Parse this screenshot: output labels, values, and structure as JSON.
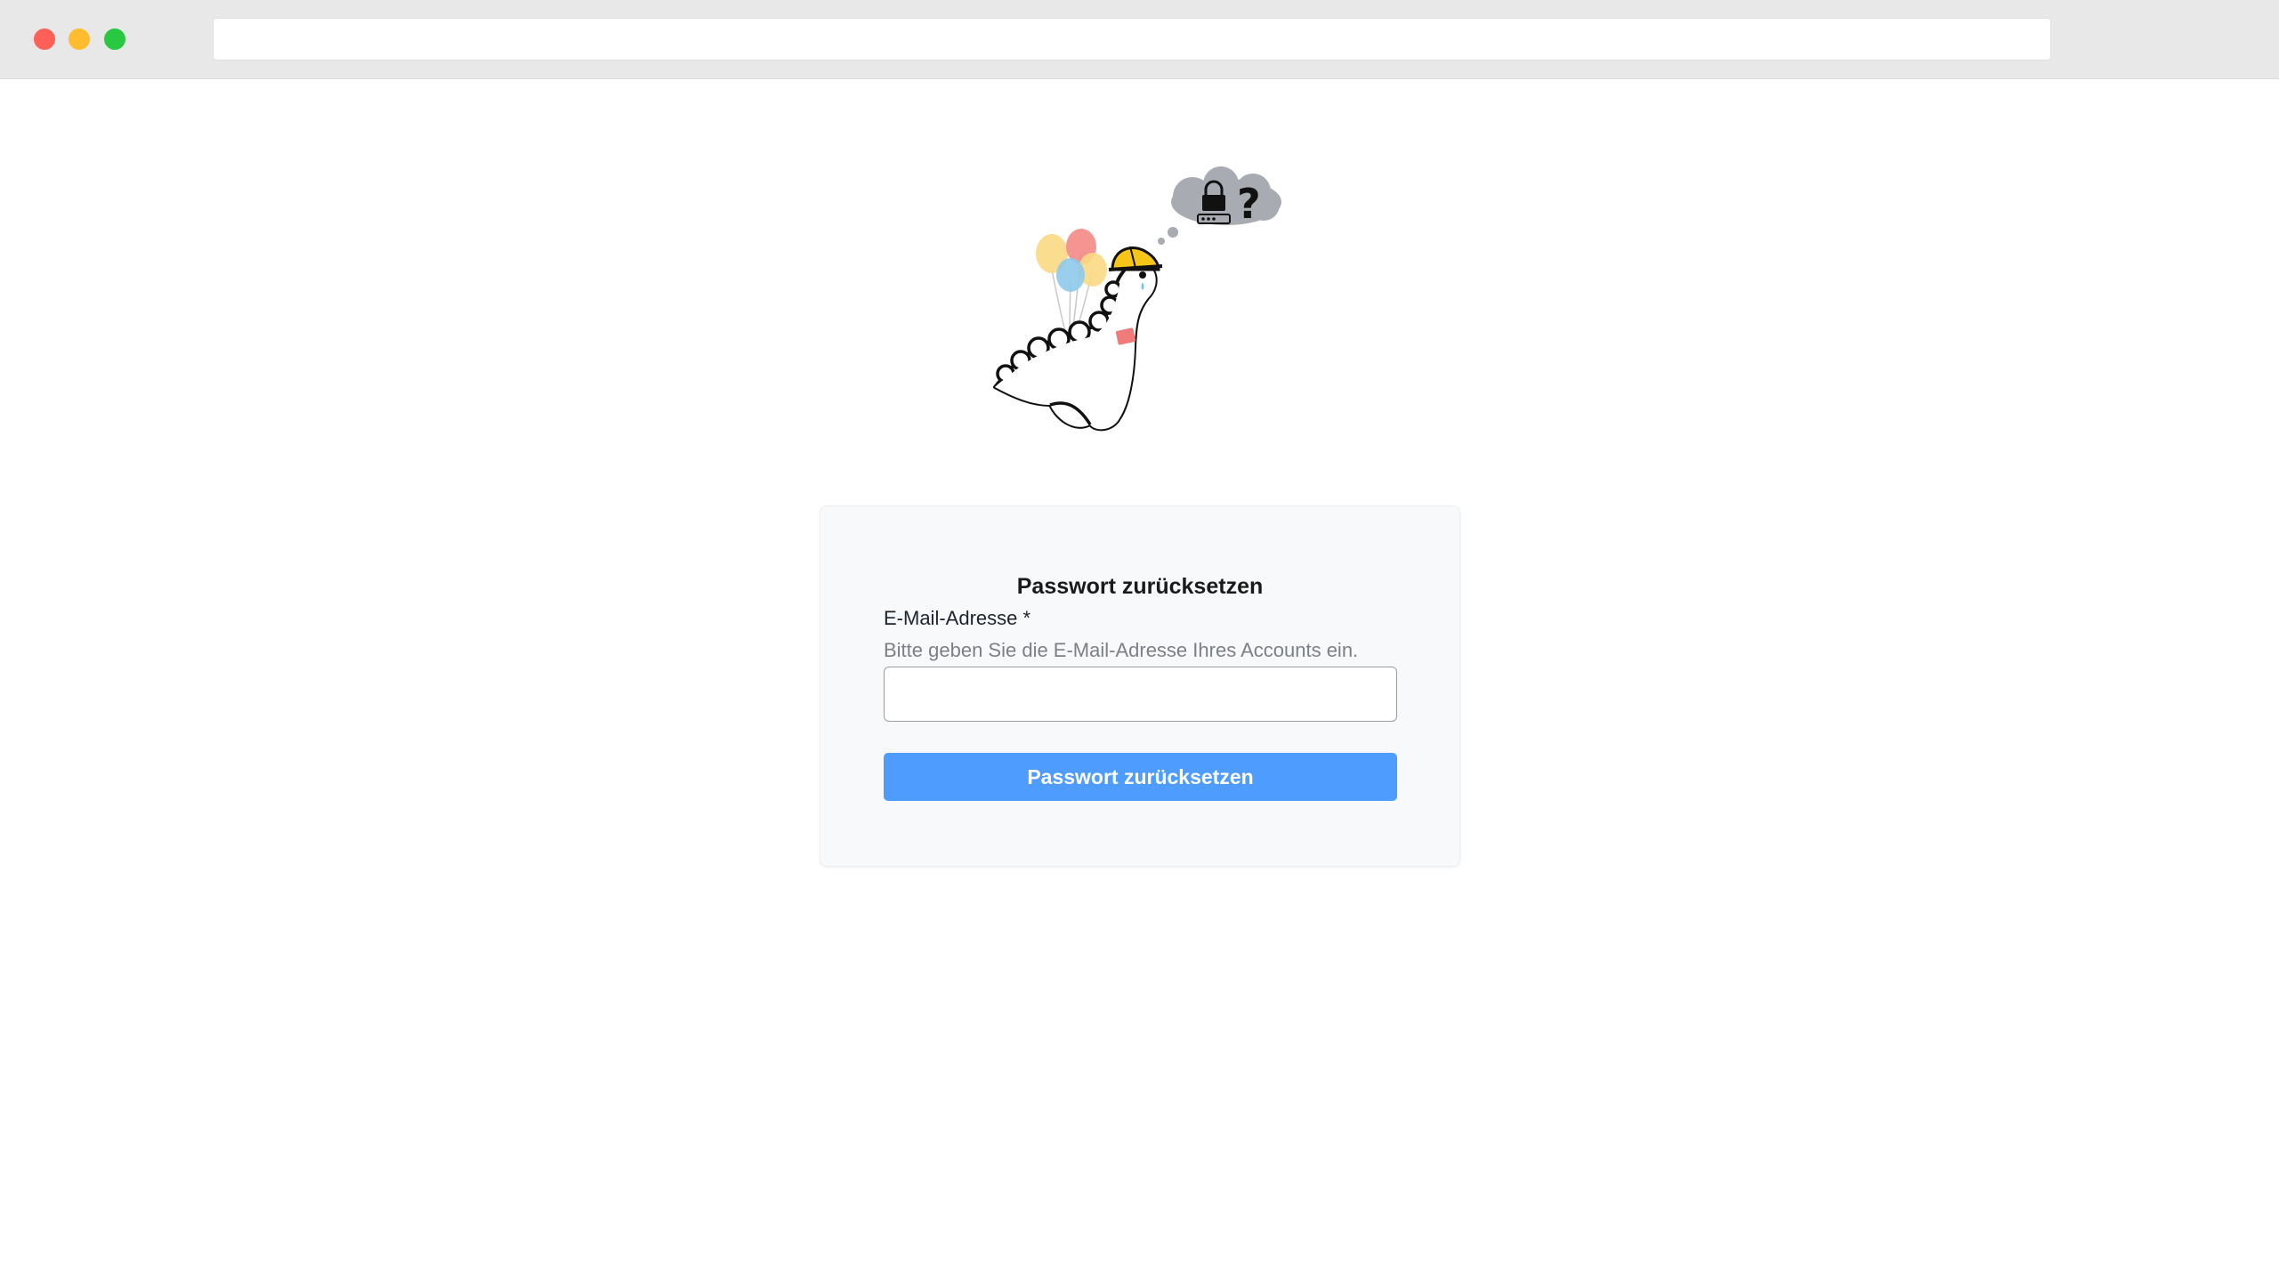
{
  "browser": {
    "address": "",
    "controls": {
      "close_color": "#fe5f57",
      "minimize_color": "#febc2e",
      "maximize_color": "#28c840"
    }
  },
  "illustration": {
    "icon": "dinosaur-with-balloons-and-thought-bubble-lock-question-icon"
  },
  "form": {
    "title": "Passwort zurücksetzen",
    "email_label": "E-Mail-Adresse *",
    "email_hint": "Bitte geben Sie die E-Mail-Adresse Ihres Accounts ein.",
    "email_value": "",
    "email_placeholder": "",
    "submit_label": "Passwort zurücksetzen"
  },
  "colors": {
    "accent": "#4f9cff",
    "card_background": "#f8f9fa",
    "hint_text": "#7c7f86"
  }
}
